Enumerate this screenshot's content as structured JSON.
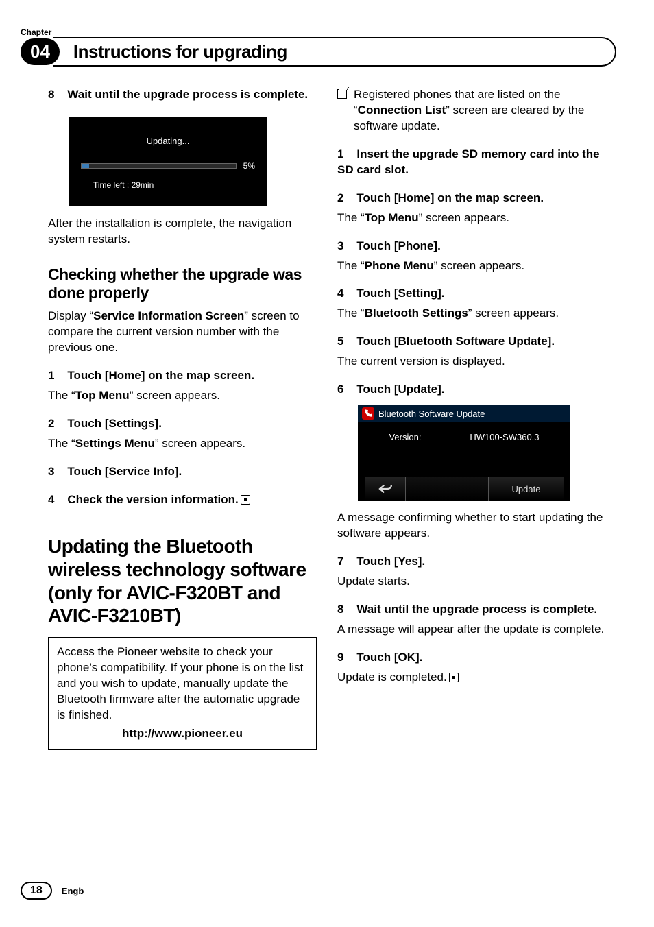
{
  "header": {
    "chapter_label": "Chapter",
    "chapter_number": "04",
    "title": "Instructions for upgrading"
  },
  "left": {
    "step8_a": "8",
    "step8_b": "Wait until the upgrade process is complete.",
    "shot1": {
      "updating": "Updating...",
      "pct": "5%",
      "time": "Time left  :  29min"
    },
    "after_install": "After the installation is complete, the navigation system restarts.",
    "check_h": "Checking whether the upgrade was done properly",
    "check_intro_a": "Display “",
    "check_intro_b": "Service Information Screen",
    "check_intro_c": "” screen to compare the current version number with the previous one.",
    "s1n": "1",
    "s1b": "Touch [Home] on the map screen.",
    "s1t_a": "The “",
    "s1t_b": "Top Menu",
    "s1t_c": "” screen appears.",
    "s2n": "2",
    "s2b": "Touch [Settings].",
    "s2t_a": "The “",
    "s2t_b": "Settings Menu",
    "s2t_c": "” screen appears.",
    "s3n": "3",
    "s3b": "Touch [Service Info].",
    "s4n": "4",
    "s4b": "Check the version information.",
    "bt_h": "Updating the Bluetooth wireless technology software (only for AVIC-F320BT and AVIC-F3210BT)",
    "note_body": "Access the Pioneer website to check your phone’s compatibility. If your phone is on the list and you wish to update, manually update the Bluetooth firmware after the automatic upgrade is finished.",
    "note_url": "http://www.pioneer.eu"
  },
  "right": {
    "bullet_a": "Registered phones that are listed on the “",
    "bullet_b": "Connection List",
    "bullet_c": "” screen are cleared by the software update.",
    "s1n": "1",
    "s1b": "Insert the upgrade SD memory card into the SD card slot.",
    "s2n": "2",
    "s2b": "Touch [Home] on the map screen.",
    "s2t_a": "The “",
    "s2t_b": "Top Menu",
    "s2t_c": "” screen appears.",
    "s3n": "3",
    "s3b": "Touch [Phone].",
    "s3t_a": "The “",
    "s3t_b": "Phone Menu",
    "s3t_c": "” screen appears.",
    "s4n": "4",
    "s4b": "Touch [Setting].",
    "s4t_a": "The “",
    "s4t_b": "Bluetooth Settings",
    "s4t_c": "” screen appears.",
    "s5n": "5",
    "s5b": "Touch [Bluetooth Software Update].",
    "s5t": "The current version is displayed.",
    "s6n": "6",
    "s6b": "Touch [Update].",
    "shot2": {
      "title": "Bluetooth Software Update",
      "version_label": "Version:",
      "version_value": "HW100-SW360.3",
      "update_btn": "Update"
    },
    "s6t": "A message confirming whether to start updating the software appears.",
    "s7n": "7",
    "s7b": "Touch [Yes].",
    "s7t": "Update starts.",
    "s8n": "8",
    "s8b": "Wait until the upgrade process is complete.",
    "s8t": "A message will appear after the update is complete.",
    "s9n": "9",
    "s9b": "Touch [OK].",
    "s9t": "Update is completed."
  },
  "footer": {
    "page": "18",
    "lang": "Engb"
  }
}
